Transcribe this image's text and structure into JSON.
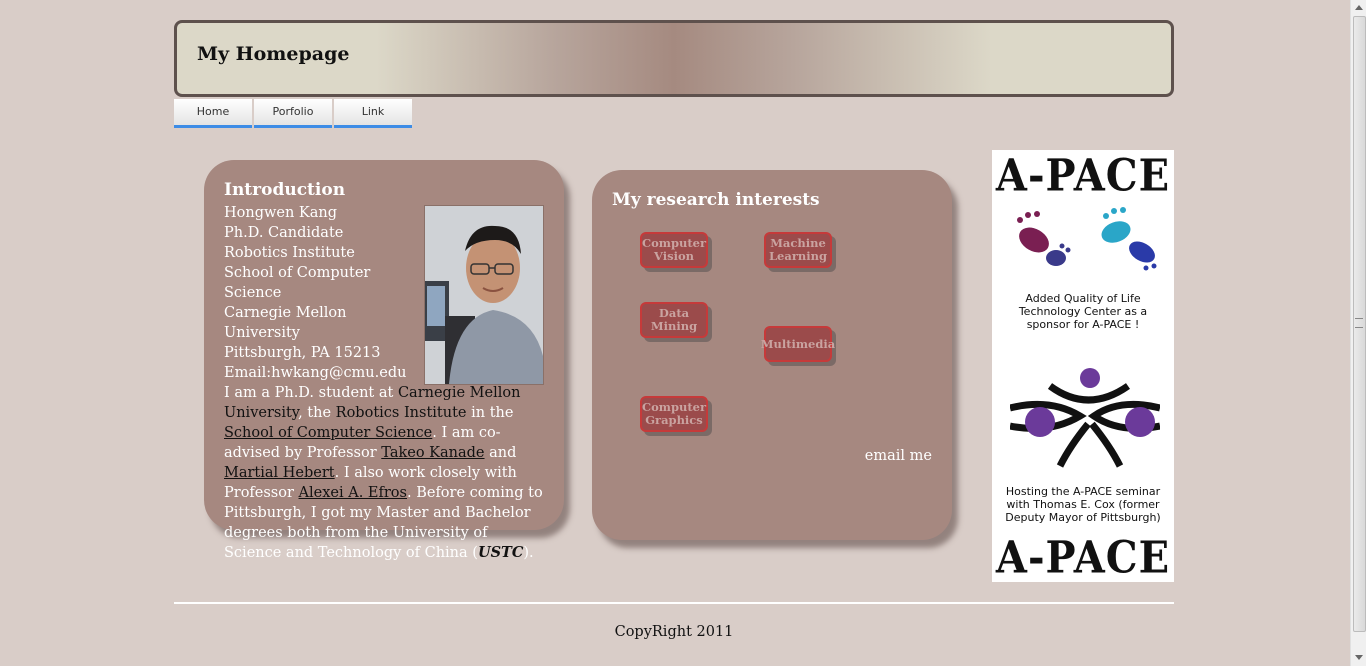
{
  "header": {
    "title": "My Homepage"
  },
  "nav": {
    "tabs": [
      "Home",
      "Porfolio",
      "Link"
    ]
  },
  "intro": {
    "heading": "Introduction",
    "contact_lines": [
      "Hongwen Kang",
      "Ph.D. Candidate",
      "Robotics Institute",
      "School of Computer Science",
      "Carnegie Mellon University",
      "Pittsburgh, PA 15213",
      "Email:hwkang@cmu.edu"
    ],
    "bio": {
      "p1": "I am a Ph.D. student at ",
      "cmu": "Carnegie Mellon University",
      "p2": ", the ",
      "ri": "Robotics Institute",
      "p3": " in the ",
      "scs": "School of Computer Science",
      "p4": ".  I am co-advised by Professor ",
      "kanade": "Takeo Kanade",
      "p5": " and ",
      "hebert": "Martial Hebert",
      "p6": ". I also work closely with Professor ",
      "efros": "Alexei A. Efros",
      "p7": ".  Before coming to Pittsburgh, I got my Master and Bachelor degrees both from the University of Science and Technology of China (",
      "ustc": "USTC",
      "p8": ")."
    }
  },
  "research": {
    "heading": "My research interests",
    "topics": [
      "Computer Vision",
      "Machine Learning",
      "Data Mining",
      "Multimedia",
      "Computer Graphics"
    ],
    "email_link": "email me"
  },
  "ad": {
    "brand": "A-PACE",
    "caption1": "Added Quality of Life Technology Center as a sponsor for A-PACE !",
    "caption2": "Hosting the A-PACE seminar with Thomas E. Cox (former Deputy Mayor of Pittsburgh)"
  },
  "footer": {
    "copyright": "CopyRight 2011"
  },
  "colors": {
    "background": "#d9cdc8",
    "card": "#a68880",
    "chip": "#9b4b4b",
    "chip_border": "#c63a3a",
    "tab_underline": "#3d8ce6"
  }
}
